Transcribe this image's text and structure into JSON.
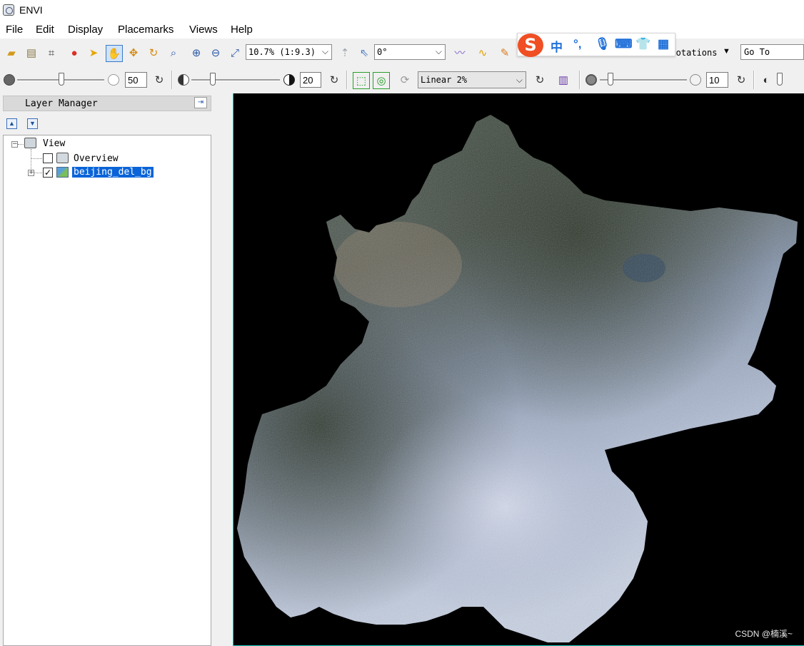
{
  "window": {
    "title": "ENVI"
  },
  "menu": [
    "File",
    "Edit",
    "Display",
    "Placemarks",
    "Views",
    "Help"
  ],
  "toolbar": {
    "zoom_value": "10.7% (1:9.3)",
    "rotation_value": "0°",
    "annotations_label": "Annotations",
    "goto_placeholder": "Go To"
  },
  "toolbar2": {
    "brightness_value": "50",
    "contrast_value": "20",
    "stretch_value": "Linear 2%",
    "sharpen_value": "10"
  },
  "ime": {
    "mode_label": "中",
    "punct_label": "°,"
  },
  "layer_manager": {
    "title": "Layer Manager",
    "tree": {
      "root": "View",
      "items": [
        {
          "label": "Overview",
          "checked": false
        },
        {
          "label": "beijing_del_bg",
          "checked": true,
          "selected": true
        }
      ]
    }
  },
  "watermark": "CSDN @楠溪~",
  "colors": {
    "selection": "#0a64d8",
    "view_border": "#19c8c0",
    "view_bg": "#000000"
  }
}
